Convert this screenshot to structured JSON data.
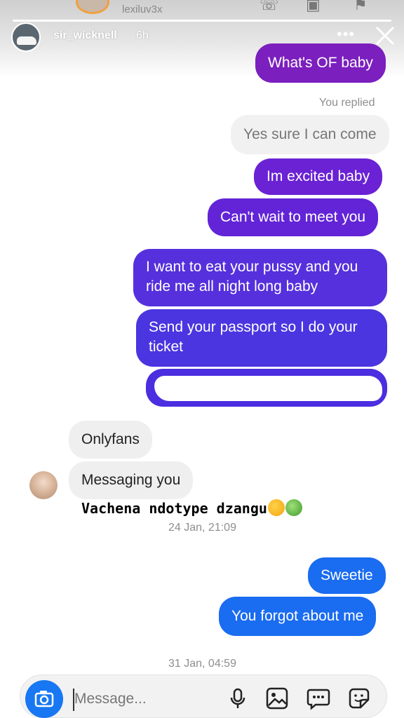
{
  "story": {
    "underlay_username": "lexiluv3x",
    "username": "sir_wicknell",
    "time": "6h",
    "more_glyph": "•••",
    "colors": {
      "progress": "#ffffff"
    }
  },
  "conversation": {
    "messages": [
      {
        "id": "m1",
        "text": "What's OF baby",
        "sender": "me",
        "color": "#7b1fbe"
      },
      {
        "id": "m2",
        "text": "Yes sure I can come",
        "sender": "me-replied-to-story",
        "color": "#f1f1f1"
      },
      {
        "id": "m3",
        "text": "Im excited baby",
        "sender": "me",
        "color": "#6a22d4"
      },
      {
        "id": "m4",
        "text": "Can't wait to meet you",
        "sender": "me",
        "color": "#6224d6"
      },
      {
        "id": "m5",
        "text": "I want to eat your pussy and you ride me all night long baby",
        "sender": "me",
        "color": "#5530dc"
      },
      {
        "id": "m6",
        "text": "Send your passport so I do your ticket",
        "sender": "me",
        "color": "#4a35e0"
      },
      {
        "id": "m7",
        "text": "Onlyfans",
        "sender": "them",
        "color": "#efefef"
      },
      {
        "id": "m8",
        "text": "Messaging you",
        "sender": "them",
        "color": "#efefef"
      },
      {
        "id": "m9",
        "text": "Sweetie",
        "sender": "me",
        "color": "#1a6cf0"
      },
      {
        "id": "m10",
        "text": "You forgot about me",
        "sender": "me",
        "color": "#1a6cf0"
      }
    ],
    "you_replied": "You replied",
    "caption": "Vachena ndotype dzangu",
    "timestamp_1": "24 Jan, 21:09",
    "timestamp_2": "31 Jan, 04:59"
  },
  "composer": {
    "placeholder": "Message...",
    "icons": [
      "camera-icon",
      "microphone-icon",
      "gallery-icon",
      "chat-bubble-icon",
      "sticker-icon"
    ],
    "accent": "#1877f2"
  }
}
